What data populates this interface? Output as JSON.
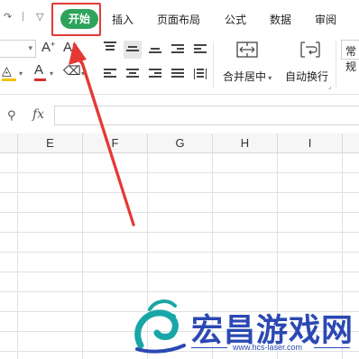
{
  "tabs": {
    "active": "开始",
    "items": [
      "插入",
      "页面布局",
      "公式",
      "数据",
      "审阅"
    ]
  },
  "ribbon": {
    "font_size_value": "",
    "increase_font": "A",
    "increase_font_sup": "+",
    "decrease_font": "A",
    "decrease_font_sup": "−",
    "font_color": "A",
    "merge_label": "合并居中",
    "wrap_label": "自动换行",
    "number_format": "常规"
  },
  "formula_bar": {
    "fx": "fx",
    "value": ""
  },
  "grid": {
    "columns": [
      "E",
      "F",
      "G",
      "H",
      "I"
    ]
  },
  "watermark": {
    "title": "宏昌游戏网",
    "url": "www.hcs-laser.com"
  },
  "colors": {
    "accent_green": "#2ea35b",
    "highlight_red": "#e53935",
    "watermark_blue": "#2b49b3"
  }
}
